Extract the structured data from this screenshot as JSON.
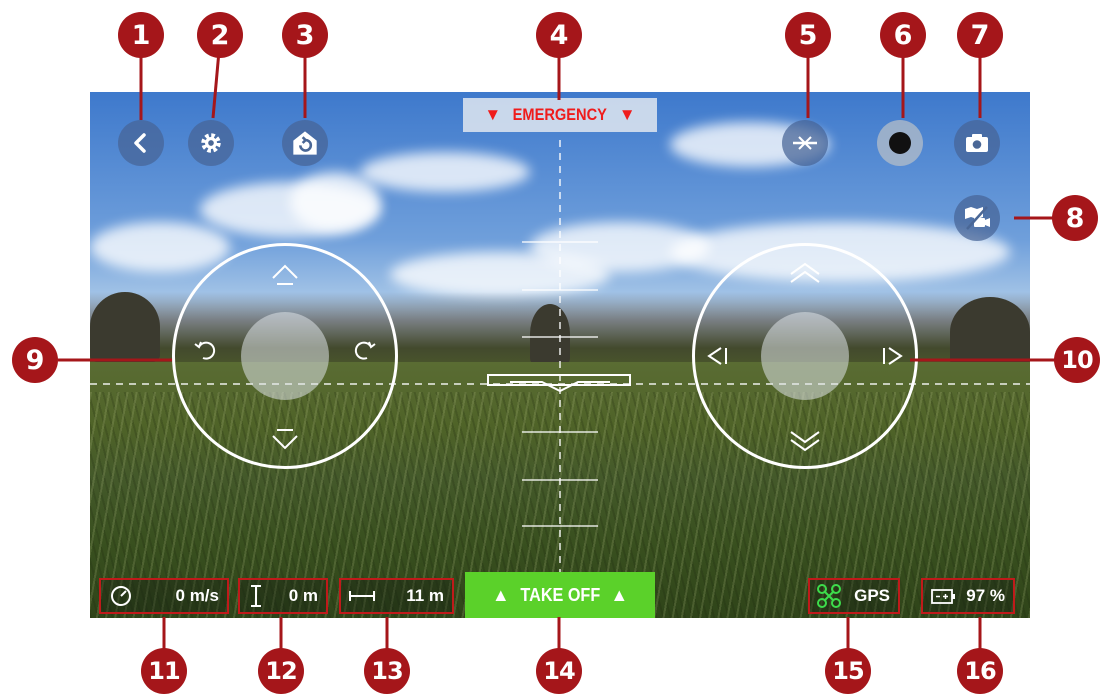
{
  "hud": {
    "emergency_label": "EMERGENCY",
    "takeoff_label": "TAKE OFF",
    "speed_value": "0 m/s",
    "altitude_value": "0 m",
    "distance_value": "11 m",
    "gps_label": "GPS",
    "battery_value": "97 %"
  },
  "icons": [
    "back-icon",
    "gear-icon",
    "return-home-icon",
    "horizon-icon",
    "record-icon",
    "camera-icon",
    "map-camera-toggle-icon",
    "speed-gauge-icon",
    "altitude-icon",
    "distance-icon",
    "drone-gps-icon",
    "battery-icon"
  ],
  "callouts": [
    "1",
    "2",
    "3",
    "4",
    "5",
    "6",
    "7",
    "8",
    "9",
    "10",
    "11",
    "12",
    "13",
    "14",
    "15",
    "16"
  ],
  "colors": {
    "callout": "#a5161a",
    "emergency": "#ef1c1c",
    "takeoff": "#5bd12a",
    "gps_icon": "#3ddc4b",
    "stat_border": "#c01a1a"
  }
}
